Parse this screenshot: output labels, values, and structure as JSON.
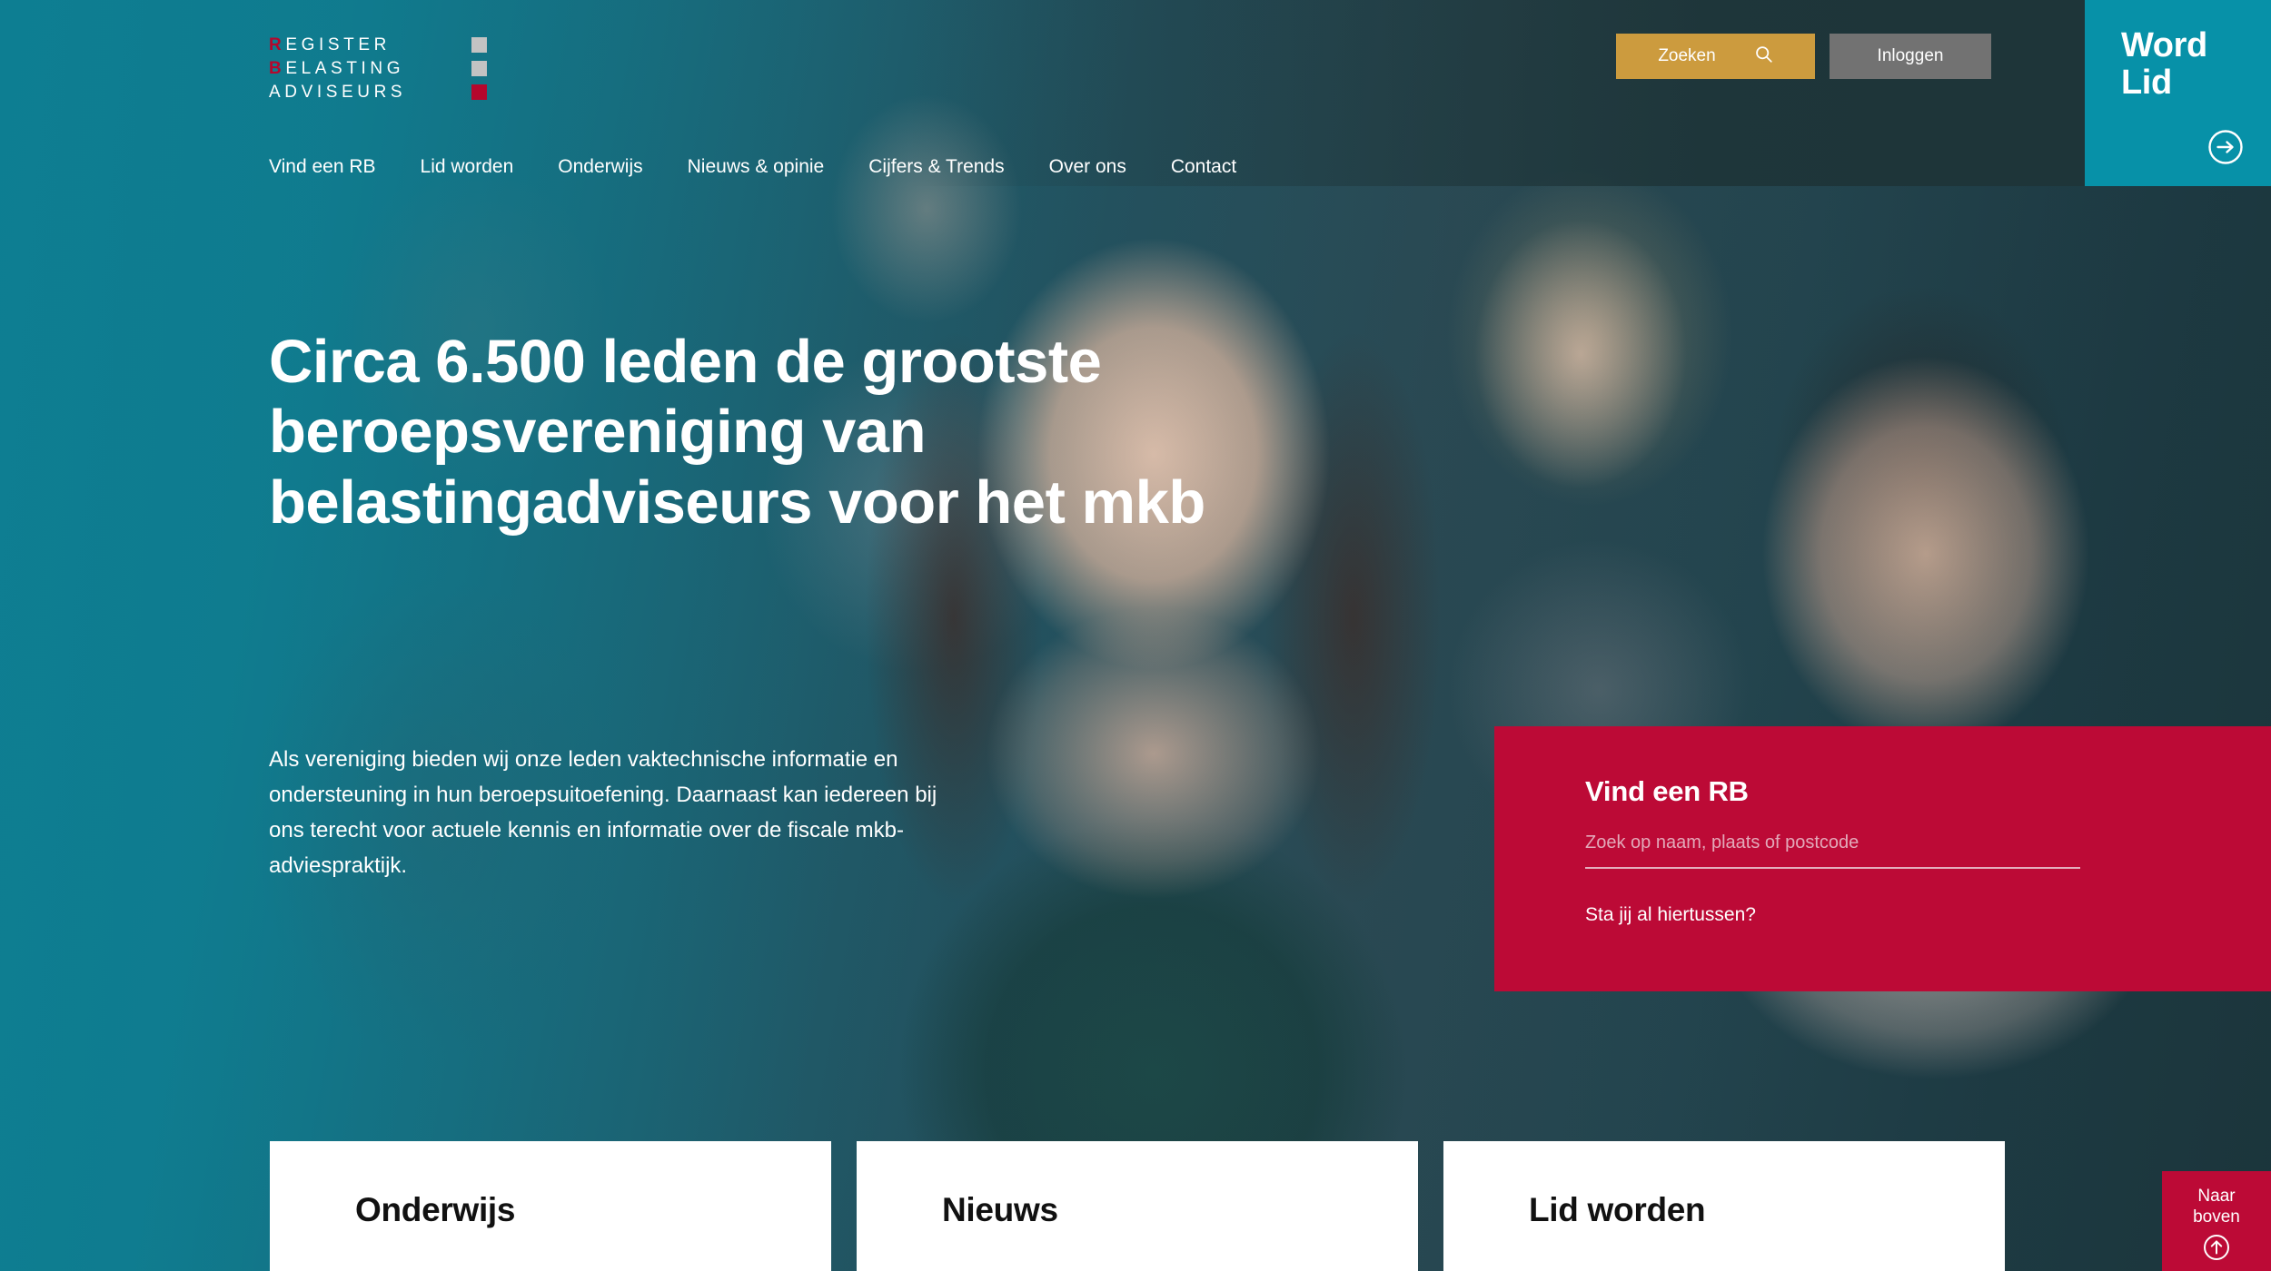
{
  "brand": {
    "logo_lines": [
      {
        "highlight": "R",
        "rest": "EGISTER",
        "square_color": "#c3c3c3"
      },
      {
        "highlight": "B",
        "rest": "ELASTING",
        "square_color": "#c3c3c3"
      },
      {
        "highlight": "",
        "rest": "ADVISEURS",
        "square_color": "#b5072c"
      }
    ],
    "logo_aria": "Register Belastingadviseurs"
  },
  "colors": {
    "teal": "#0791a8",
    "dark_teal": "#1e3539",
    "gold": "#cc9b3e",
    "gray_button": "#727272",
    "red": "#bc0a36",
    "logo_red": "#b5072c"
  },
  "topbar": {
    "search_button_label": "Zoeken",
    "search_icon": "search-icon",
    "login_button_label": "Inloggen",
    "word_lid_line1": "Word",
    "word_lid_line2": "Lid",
    "word_lid_icon": "arrow-right-circle-icon"
  },
  "nav": {
    "items": [
      {
        "label": "Vind een RB"
      },
      {
        "label": "Lid worden"
      },
      {
        "label": "Onderwijs"
      },
      {
        "label": "Nieuws & opinie"
      },
      {
        "label": "Cijfers & Trends"
      },
      {
        "label": "Over ons"
      },
      {
        "label": "Contact"
      }
    ]
  },
  "hero": {
    "title": "Circa 6.500 leden de grootste beroepsvereniging van belastingadviseurs voor het mkb",
    "subtitle": "Als vereniging bieden wij onze leden vaktechnische informatie en ondersteuning in hun beroepsuitoefening. Daarnaast kan iedereen bij ons terecht voor actuele kennis en informatie over de fiscale mkb-adviespraktijk."
  },
  "find_card": {
    "title": "Vind een RB",
    "input_placeholder": "Zoek op naam, plaats of postcode",
    "input_value": "",
    "link_label": "Sta jij al hiertussen?"
  },
  "cards": [
    {
      "title": "Onderwijs"
    },
    {
      "title": "Nieuws"
    },
    {
      "title": "Lid worden"
    }
  ],
  "back_to_top": {
    "line1": "Naar",
    "line2": "boven",
    "icon": "arrow-up-circle-icon"
  }
}
